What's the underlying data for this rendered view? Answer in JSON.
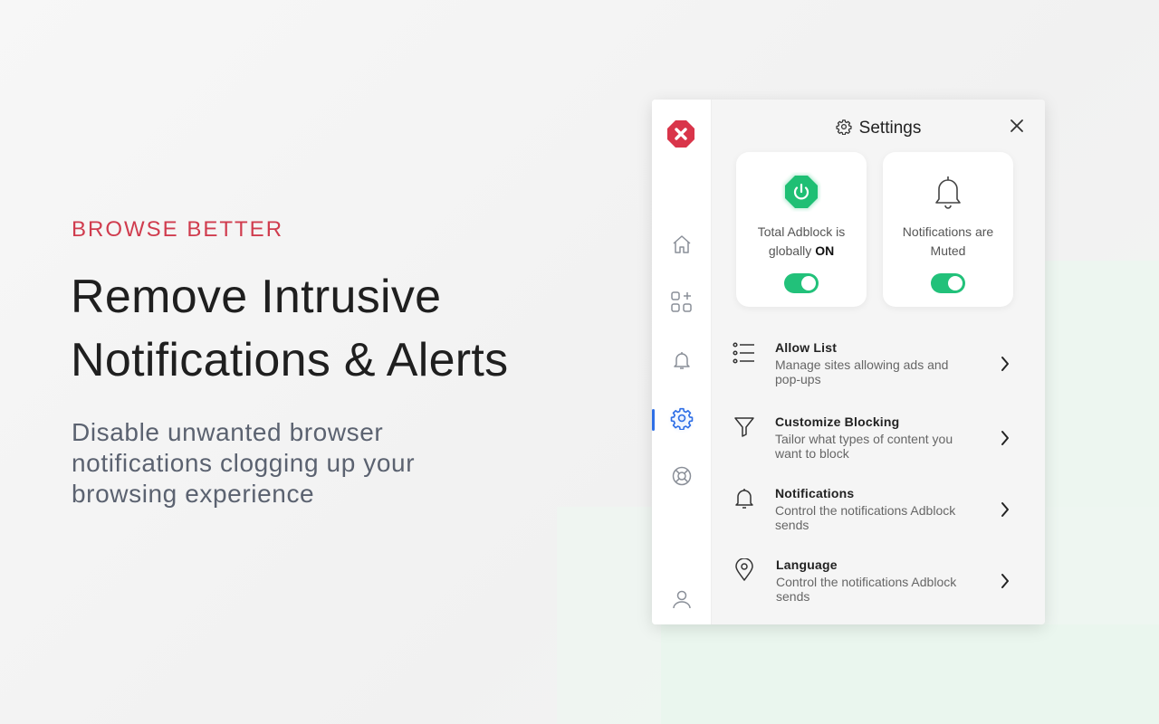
{
  "hero": {
    "eyebrow": "BROWSE BETTER",
    "headline_line1": "Remove Intrusive",
    "headline_line2": "Notifications & Alerts",
    "subhead": "Disable unwanted browser notifications clogging up your browsing experience"
  },
  "colors": {
    "accent_red": "#d03c4e",
    "toggle_green": "#22c17a",
    "active_blue": "#2f6fe6"
  },
  "sidebar": {
    "items": [
      {
        "icon": "home-icon"
      },
      {
        "icon": "apps-add-icon"
      },
      {
        "icon": "bell-icon"
      },
      {
        "icon": "gear-icon",
        "active": true
      },
      {
        "icon": "lifebuoy-icon"
      },
      {
        "icon": "user-icon"
      }
    ]
  },
  "header": {
    "title": "Settings",
    "icon": "gear-icon",
    "close_icon": "close-icon"
  },
  "cards": {
    "adblock": {
      "text_prefix": "Total Adblock is globally ",
      "text_state": "ON",
      "toggle_on": true
    },
    "notifications": {
      "text": "Notifications are Muted",
      "toggle_on": true
    }
  },
  "menu": [
    {
      "title": "Allow List",
      "desc": "Manage sites allowing ads and pop-ups",
      "icon": "list-icon"
    },
    {
      "title": "Customize Blocking",
      "desc": "Tailor what types of content you want to block",
      "icon": "filter-icon"
    },
    {
      "title": "Notifications",
      "desc": "Control the notifications Adblock sends",
      "icon": "bell-icon"
    },
    {
      "title": "Language",
      "desc": "Control the notifications Adblock sends",
      "icon": "location-pin-icon"
    }
  ]
}
